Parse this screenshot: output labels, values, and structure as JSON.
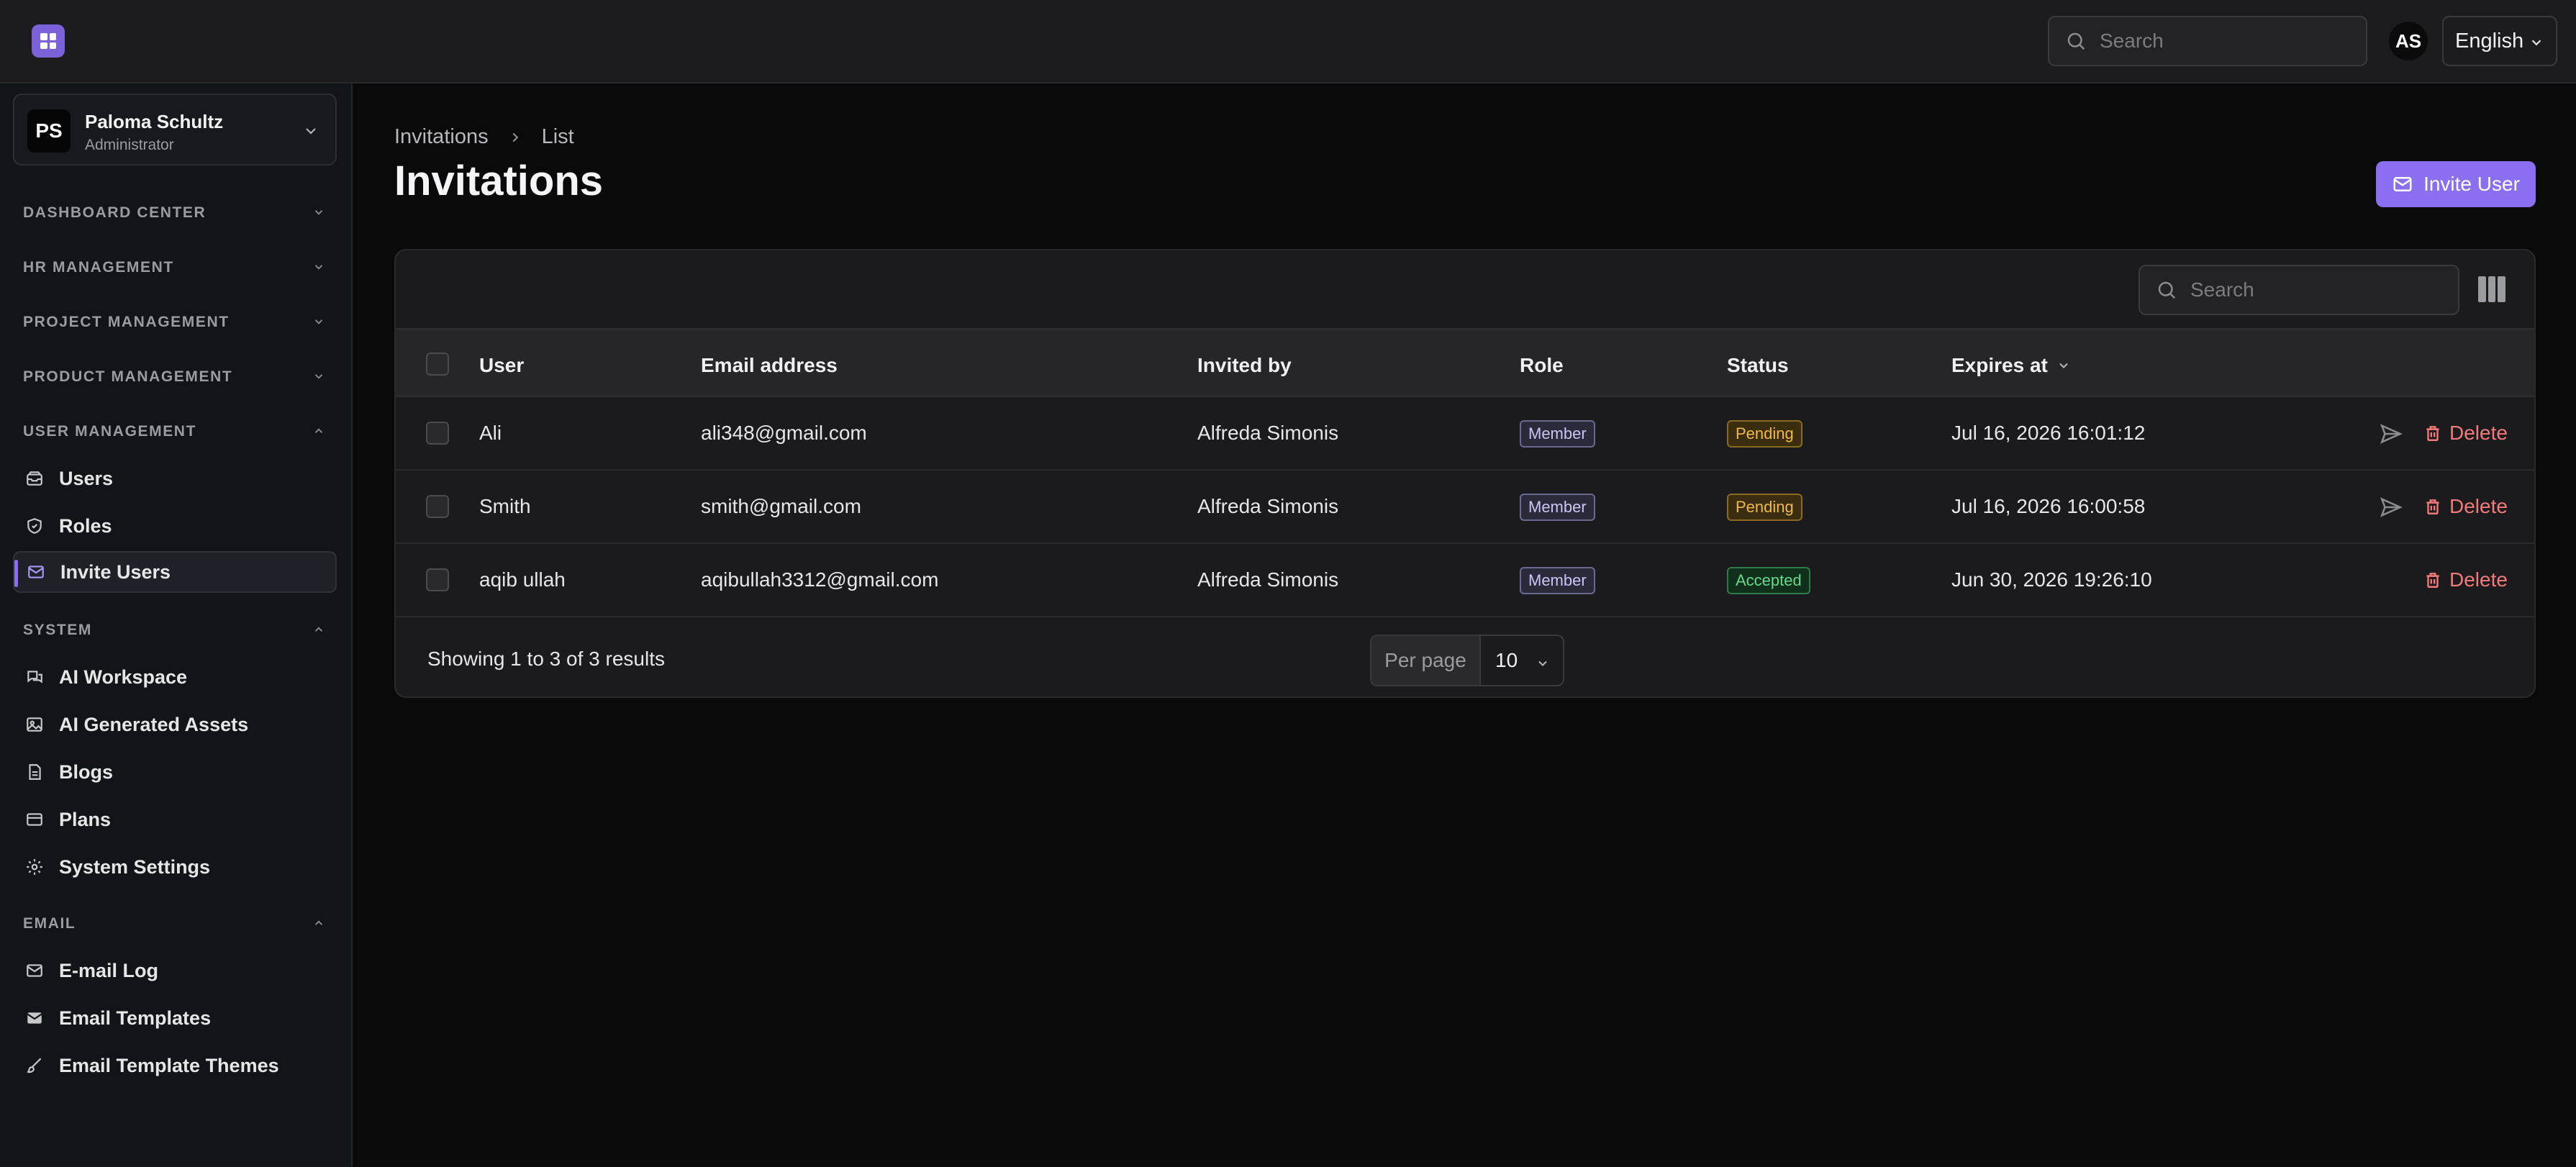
{
  "topbar": {
    "search_placeholder": "Search",
    "avatar_initials": "AS",
    "language": "English"
  },
  "sidebar": {
    "user": {
      "initials": "PS",
      "name": "Paloma Schultz",
      "role": "Administrator"
    },
    "sections": {
      "dashboard": "DASHBOARD CENTER",
      "hr": "HR MANAGEMENT",
      "project": "PROJECT MANAGEMENT",
      "product": "PRODUCT MANAGEMENT",
      "user_mgmt": "USER MANAGEMENT",
      "system": "SYSTEM",
      "email": "EMAIL"
    },
    "items": {
      "users": "Users",
      "roles": "Roles",
      "invite_users": "Invite Users",
      "ai_workspace": "AI Workspace",
      "ai_assets": "AI Generated Assets",
      "blogs": "Blogs",
      "plans": "Plans",
      "system_settings": "System Settings",
      "email_log": "E-mail Log",
      "email_templates": "Email Templates",
      "email_template_themes": "Email Template Themes"
    }
  },
  "main": {
    "breadcrumb": [
      "Invitations",
      "List"
    ],
    "title": "Invitations",
    "invite_button": "Invite User",
    "table": {
      "search_placeholder": "Search",
      "columns": [
        "User",
        "Email address",
        "Invited by",
        "Role",
        "Status",
        "Expires at"
      ],
      "rows": [
        {
          "user": "Ali",
          "email": "ali348@gmail.com",
          "invited_by": "Alfreda Simonis",
          "role": "Member",
          "status": "Pending",
          "expires": "Jul 16, 2026 16:01:12",
          "action": "Delete"
        },
        {
          "user": "Smith",
          "email": "smith@gmail.com",
          "invited_by": "Alfreda Simonis",
          "role": "Member",
          "status": "Pending",
          "expires": "Jul 16, 2026 16:00:58",
          "action": "Delete"
        },
        {
          "user": "aqib ullah",
          "email": "aqibullah3312@gmail.com",
          "invited_by": "Alfreda Simonis",
          "role": "Member",
          "status": "Accepted",
          "expires": "Jun 30, 2026 19:26:10",
          "action": "Delete"
        }
      ],
      "footer": "Showing 1 to 3 of 3 results",
      "per_page_label": "Per page",
      "per_page_value": "10"
    }
  },
  "colors": {
    "accent": "#8b6ff0",
    "pending": "#f1b94a",
    "accepted": "#67d98b",
    "delete": "#f27a7a"
  }
}
